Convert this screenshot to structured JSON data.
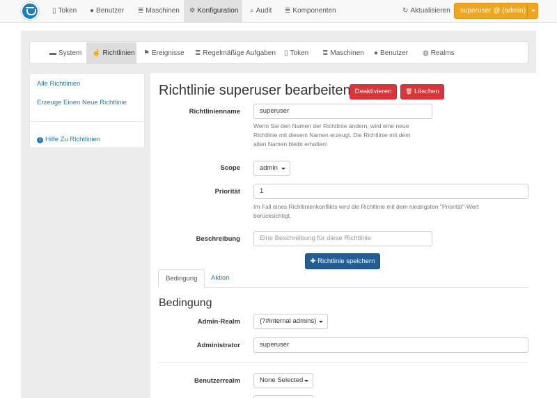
{
  "navbar": {
    "items": [
      {
        "icon": "mobile-icon",
        "glyph": "▯",
        "label": "Token"
      },
      {
        "icon": "user-icon",
        "glyph": "●",
        "label": "Benutzer"
      },
      {
        "icon": "list-icon",
        "glyph": "≣",
        "label": "Maschinen"
      },
      {
        "icon": "cog-icon",
        "glyph": "✲",
        "label": "Konfiguration"
      },
      {
        "icon": "search-icon",
        "glyph": "⌕",
        "label": "Audit"
      },
      {
        "icon": "list-icon",
        "glyph": "≣",
        "label": "Komponenten"
      }
    ],
    "refresh": {
      "icon": "refresh-icon",
      "glyph": "↻",
      "label": "Aktualisieren"
    },
    "user": "superuser @ (admin)",
    "accent": "#f0a51f"
  },
  "subnav": {
    "items": [
      {
        "icon": "briefcase-icon",
        "glyph": "▬",
        "label": "System"
      },
      {
        "icon": "thumbs-up-icon",
        "glyph": "☝",
        "label": "Richtlinien"
      },
      {
        "icon": "flag-icon",
        "glyph": "⚑",
        "label": "Ereignisse"
      },
      {
        "icon": "list-icon",
        "glyph": "≣",
        "label": "Regelmäßige Aufgaben"
      },
      {
        "icon": "mobile-icon",
        "glyph": "▯",
        "label": "Token"
      },
      {
        "icon": "list-icon",
        "glyph": "≣",
        "label": "Maschinen"
      },
      {
        "icon": "user-icon",
        "glyph": "●",
        "label": "Benutzer"
      },
      {
        "icon": "globe-icon",
        "glyph": "◍",
        "label": "Realms"
      }
    ]
  },
  "sidebar": {
    "all_policies": "Alle Richtlinien",
    "new_policy": "Erzeuge Einen Neue Richtlinie",
    "help": "Hilfe Zu Richtlinien"
  },
  "main": {
    "title": "Richtlinie superuser bearbeiten",
    "deactivate": "Deaktivieren",
    "delete": "Löschen",
    "delete_glyph": "🗑",
    "name_label": "Richtlinienname",
    "name_value": "superuser",
    "name_help_1": "Wenn Sie den Namen der Richtlinie ändern, wird eine neue",
    "name_help_2": "Richtlinie mit diesem Namen erzeugt. Die Richtlinie mit dem",
    "name_help_3": "alten Namen bleibt erhalten!",
    "scope_label": "Scope",
    "scope_value": "admin",
    "priority_label": "Priorität",
    "priority_value": "1",
    "priority_help_1": "Im Fall eines Richtlinienkonflikts wird die Richtlinie mit dem niedrigsten \"Priorität\"-Wert",
    "priority_help_2": "berücksichtigt.",
    "desc_label": "Beschreibung",
    "desc_placeholder": "Eine Beschreibung für diese Richtlinie",
    "save": "Richtlinie speichern",
    "save_glyph": "✚",
    "tabs": [
      "Bedingung",
      "Aktion"
    ],
    "section_title": "Bedingung",
    "admin_realm_label": "Admin-Realm",
    "admin_realm_value": "(?#internal admins)",
    "administrator_label": "Administrator",
    "administrator_value": "superuser",
    "user_realm_label": "Benutzerrealm",
    "user_realm_value": "None Selected"
  }
}
